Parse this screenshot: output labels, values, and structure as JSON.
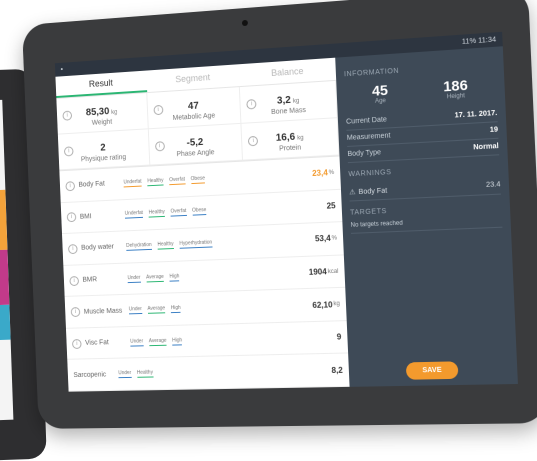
{
  "status": {
    "time": "11:34",
    "battery": "11%"
  },
  "tabs": [
    {
      "label": "Result"
    },
    {
      "label": "Segment"
    },
    {
      "label": "Balance"
    }
  ],
  "tiles": [
    {
      "value": "85,30",
      "unit": "kg",
      "label": "Weight"
    },
    {
      "value": "47",
      "unit": "",
      "label": "Metabolic Age"
    },
    {
      "value": "3,2",
      "unit": "kg",
      "label": "Bone Mass"
    },
    {
      "value": "2",
      "unit": "",
      "label": "Physique rating"
    },
    {
      "value": "-5,2",
      "unit": "",
      "label": "Phase Angle"
    },
    {
      "value": "16,6",
      "unit": "kg",
      "label": "Protein"
    }
  ],
  "rows": [
    {
      "name": "Body Fat",
      "scale": [
        "Underfat",
        "Healthy",
        "Overfat",
        "Obese"
      ],
      "value": "23,4",
      "unit": "%"
    },
    {
      "name": "BMI",
      "scale": [
        "Underfat",
        "Healthy",
        "Overfat",
        "Obese"
      ],
      "value": "25",
      "unit": ""
    },
    {
      "name": "Body water",
      "scale": [
        "Dehydration",
        "Healthy",
        "Hyperhydration"
      ],
      "value": "53,4",
      "unit": "%"
    },
    {
      "name": "BMR",
      "scale": [
        "Under",
        "Average",
        "High"
      ],
      "value": "1904",
      "unit": "kcal"
    },
    {
      "name": "Muscle Mass",
      "scale": [
        "Under",
        "Average",
        "High"
      ],
      "value": "62,10",
      "unit": "kg"
    },
    {
      "name": "Visc Fat",
      "scale": [
        "Under",
        "Average",
        "High"
      ],
      "value": "9",
      "unit": ""
    },
    {
      "name": "Sarcopenic",
      "scale": [
        "Under",
        "Healthy"
      ],
      "value": "8,2",
      "unit": ""
    }
  ],
  "info": {
    "heading": "INFORMATION",
    "age": "45",
    "age_label": "Age",
    "height": "186",
    "height_label": "Height",
    "current_date_label": "Current Date",
    "current_date": "17. 11. 2017.",
    "measurement_label": "Measurement",
    "measurement": "19",
    "body_type_label": "Body Type",
    "body_type": "Normal"
  },
  "warnings": {
    "heading": "WARNINGS",
    "item": "Body Fat",
    "value": "23.4"
  },
  "targets": {
    "heading": "TARGETS",
    "text": "No targets reached"
  },
  "save_label": "SAVE",
  "colors": {
    "accent": "#f39a2d",
    "panel": "#3e4a57",
    "healthy": "#2bb673"
  }
}
